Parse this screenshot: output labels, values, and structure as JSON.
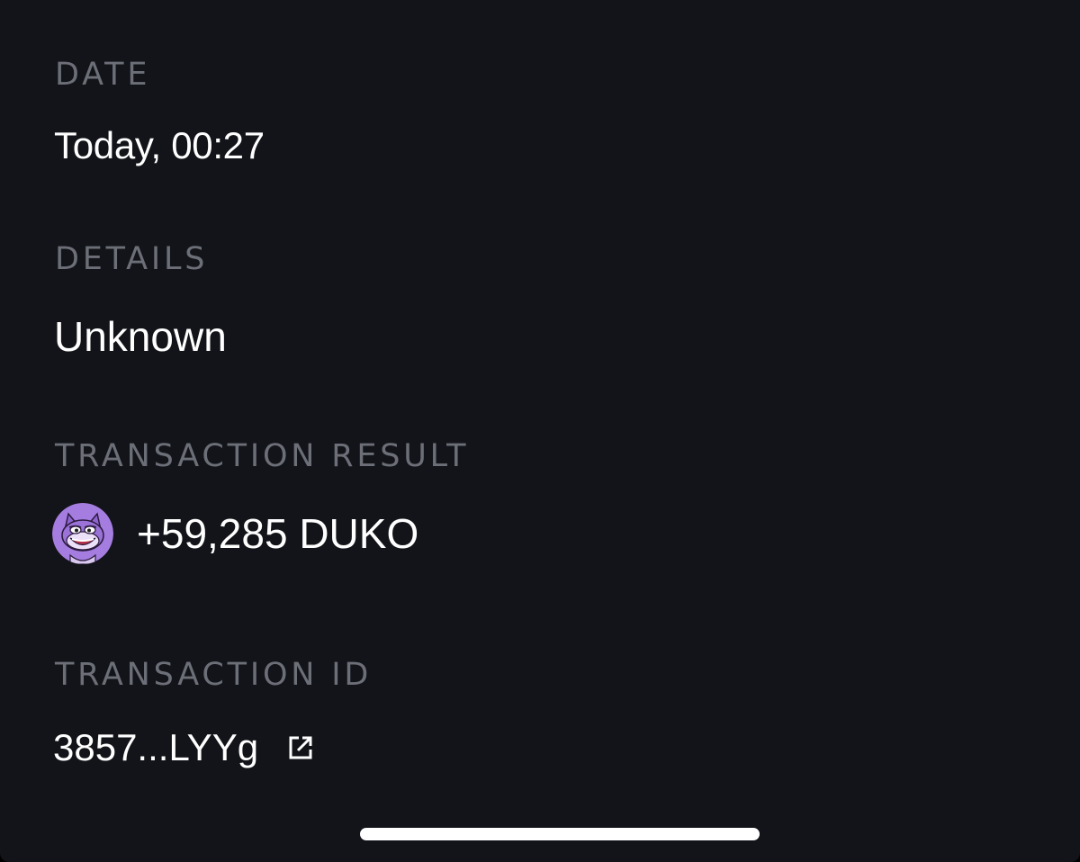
{
  "date": {
    "label": "DATE",
    "value": "Today, 00:27"
  },
  "details": {
    "label": "DETAILS",
    "value": "Unknown"
  },
  "transaction_result": {
    "label": "TRANSACTION RESULT",
    "token_icon": "duko-token-avatar",
    "amount": "+59,285 DUKO"
  },
  "transaction_id": {
    "label": "TRANSACTION ID",
    "value": "3857...LYYg",
    "link_icon": "external-link-icon"
  },
  "colors": {
    "background": "#121419",
    "label": "#6c6f77",
    "text": "#ffffff",
    "token_avatar": "#a57de0"
  }
}
